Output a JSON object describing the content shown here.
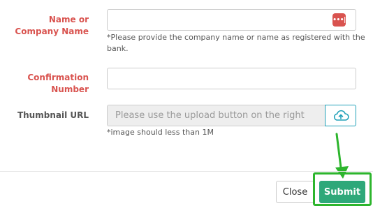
{
  "form": {
    "name_label_line1": "Name or",
    "name_label_line2": "Company Name",
    "name_value": "",
    "name_help_line1": "*Please provide the company name or name as registered with the",
    "name_help_line2": "bank.",
    "password_icon_glyph": "•••|",
    "confirmation_label_line1": "Confirmation",
    "confirmation_label_line2": "Number",
    "confirmation_value": "",
    "thumbnail_label": "Thumbnail URL",
    "thumbnail_placeholder": "Please use the upload button on the right",
    "thumbnail_help": "*image should less than 1M"
  },
  "footer": {
    "close_label": "Close",
    "submit_label": "Submit"
  },
  "icons": {
    "password_manager": "password-dots-icon",
    "upload": "cloud-upload-icon",
    "annotation": "arrow-down-icon"
  },
  "colors": {
    "required_label": "#d9534f",
    "submit_bg": "#2ea879",
    "highlight": "#2db52d",
    "upload_border": "#20a0b8"
  }
}
